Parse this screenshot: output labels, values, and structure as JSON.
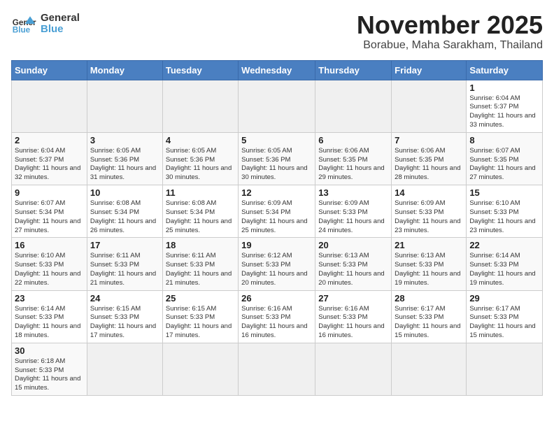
{
  "header": {
    "logo_general": "General",
    "logo_blue": "Blue",
    "month": "November 2025",
    "location": "Borabue, Maha Sarakham, Thailand"
  },
  "weekdays": [
    "Sunday",
    "Monday",
    "Tuesday",
    "Wednesday",
    "Thursday",
    "Friday",
    "Saturday"
  ],
  "weeks": [
    [
      {
        "day": "",
        "empty": true
      },
      {
        "day": "",
        "empty": true
      },
      {
        "day": "",
        "empty": true
      },
      {
        "day": "",
        "empty": true
      },
      {
        "day": "",
        "empty": true
      },
      {
        "day": "",
        "empty": true
      },
      {
        "day": "1",
        "sunrise": "6:04 AM",
        "sunset": "5:37 PM",
        "daylight": "11 hours and 33 minutes."
      }
    ],
    [
      {
        "day": "2",
        "sunrise": "6:04 AM",
        "sunset": "5:37 PM",
        "daylight": "11 hours and 32 minutes."
      },
      {
        "day": "3",
        "sunrise": "6:05 AM",
        "sunset": "5:36 PM",
        "daylight": "11 hours and 31 minutes."
      },
      {
        "day": "4",
        "sunrise": "6:05 AM",
        "sunset": "5:36 PM",
        "daylight": "11 hours and 30 minutes."
      },
      {
        "day": "5",
        "sunrise": "6:05 AM",
        "sunset": "5:36 PM",
        "daylight": "11 hours and 30 minutes."
      },
      {
        "day": "6",
        "sunrise": "6:06 AM",
        "sunset": "5:35 PM",
        "daylight": "11 hours and 29 minutes."
      },
      {
        "day": "7",
        "sunrise": "6:06 AM",
        "sunset": "5:35 PM",
        "daylight": "11 hours and 28 minutes."
      },
      {
        "day": "8",
        "sunrise": "6:07 AM",
        "sunset": "5:35 PM",
        "daylight": "11 hours and 27 minutes."
      }
    ],
    [
      {
        "day": "9",
        "sunrise": "6:07 AM",
        "sunset": "5:34 PM",
        "daylight": "11 hours and 27 minutes."
      },
      {
        "day": "10",
        "sunrise": "6:08 AM",
        "sunset": "5:34 PM",
        "daylight": "11 hours and 26 minutes."
      },
      {
        "day": "11",
        "sunrise": "6:08 AM",
        "sunset": "5:34 PM",
        "daylight": "11 hours and 25 minutes."
      },
      {
        "day": "12",
        "sunrise": "6:09 AM",
        "sunset": "5:34 PM",
        "daylight": "11 hours and 25 minutes."
      },
      {
        "day": "13",
        "sunrise": "6:09 AM",
        "sunset": "5:33 PM",
        "daylight": "11 hours and 24 minutes."
      },
      {
        "day": "14",
        "sunrise": "6:09 AM",
        "sunset": "5:33 PM",
        "daylight": "11 hours and 23 minutes."
      },
      {
        "day": "15",
        "sunrise": "6:10 AM",
        "sunset": "5:33 PM",
        "daylight": "11 hours and 23 minutes."
      }
    ],
    [
      {
        "day": "16",
        "sunrise": "6:10 AM",
        "sunset": "5:33 PM",
        "daylight": "11 hours and 22 minutes."
      },
      {
        "day": "17",
        "sunrise": "6:11 AM",
        "sunset": "5:33 PM",
        "daylight": "11 hours and 21 minutes."
      },
      {
        "day": "18",
        "sunrise": "6:11 AM",
        "sunset": "5:33 PM",
        "daylight": "11 hours and 21 minutes."
      },
      {
        "day": "19",
        "sunrise": "6:12 AM",
        "sunset": "5:33 PM",
        "daylight": "11 hours and 20 minutes."
      },
      {
        "day": "20",
        "sunrise": "6:13 AM",
        "sunset": "5:33 PM",
        "daylight": "11 hours and 20 minutes."
      },
      {
        "day": "21",
        "sunrise": "6:13 AM",
        "sunset": "5:33 PM",
        "daylight": "11 hours and 19 minutes."
      },
      {
        "day": "22",
        "sunrise": "6:14 AM",
        "sunset": "5:33 PM",
        "daylight": "11 hours and 19 minutes."
      }
    ],
    [
      {
        "day": "23",
        "sunrise": "6:14 AM",
        "sunset": "5:33 PM",
        "daylight": "11 hours and 18 minutes."
      },
      {
        "day": "24",
        "sunrise": "6:15 AM",
        "sunset": "5:33 PM",
        "daylight": "11 hours and 17 minutes."
      },
      {
        "day": "25",
        "sunrise": "6:15 AM",
        "sunset": "5:33 PM",
        "daylight": "11 hours and 17 minutes."
      },
      {
        "day": "26",
        "sunrise": "6:16 AM",
        "sunset": "5:33 PM",
        "daylight": "11 hours and 16 minutes."
      },
      {
        "day": "27",
        "sunrise": "6:16 AM",
        "sunset": "5:33 PM",
        "daylight": "11 hours and 16 minutes."
      },
      {
        "day": "28",
        "sunrise": "6:17 AM",
        "sunset": "5:33 PM",
        "daylight": "11 hours and 15 minutes."
      },
      {
        "day": "29",
        "sunrise": "6:17 AM",
        "sunset": "5:33 PM",
        "daylight": "11 hours and 15 minutes."
      }
    ],
    [
      {
        "day": "30",
        "sunrise": "6:18 AM",
        "sunset": "5:33 PM",
        "daylight": "11 hours and 15 minutes."
      },
      {
        "day": "",
        "empty": true
      },
      {
        "day": "",
        "empty": true
      },
      {
        "day": "",
        "empty": true
      },
      {
        "day": "",
        "empty": true
      },
      {
        "day": "",
        "empty": true
      },
      {
        "day": "",
        "empty": true
      }
    ]
  ],
  "labels": {
    "sunrise": "Sunrise:",
    "sunset": "Sunset:",
    "daylight": "Daylight:"
  }
}
